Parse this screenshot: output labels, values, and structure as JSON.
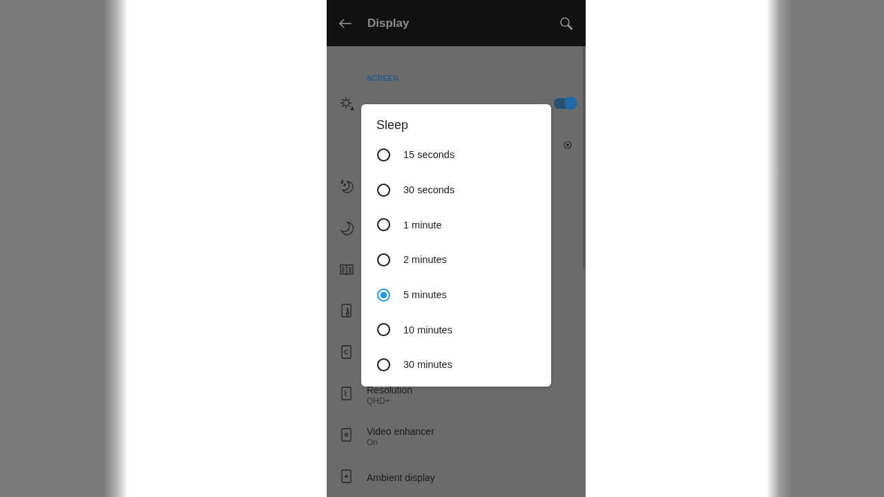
{
  "app_bar": {
    "title": "Display"
  },
  "section": "SCREEN",
  "settings": [
    {
      "kind": "brightness",
      "toggle": {
        "on": true
      }
    },
    {
      "kind": "level"
    },
    {
      "kind": "night"
    },
    {
      "kind": "moon"
    },
    {
      "kind": "book"
    },
    {
      "kind": "thermo"
    },
    {
      "kind": "cycle"
    },
    {
      "kind": "resolution",
      "title": "Resolution",
      "subtitle": "QHD+"
    },
    {
      "kind": "video",
      "title": "Video enhancer",
      "subtitle": "On"
    },
    {
      "kind": "ambient",
      "title": "Ambient display"
    }
  ],
  "dialog": {
    "title": "Sleep",
    "options": [
      {
        "label": "15 seconds",
        "selected": false
      },
      {
        "label": "30 seconds",
        "selected": false
      },
      {
        "label": "1 minute",
        "selected": false
      },
      {
        "label": "2 minutes",
        "selected": false
      },
      {
        "label": "5 minutes",
        "selected": true
      },
      {
        "label": "10 minutes",
        "selected": false
      },
      {
        "label": "30 minutes",
        "selected": false
      }
    ]
  }
}
